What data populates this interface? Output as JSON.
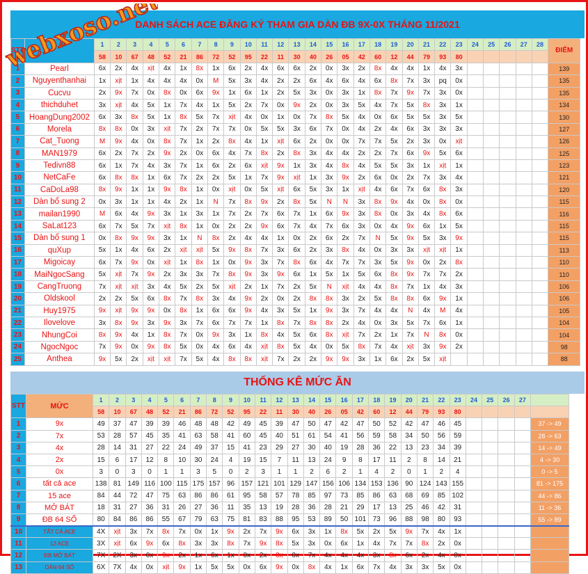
{
  "title": "DANH SÁCH ACE ĐĂNG KÝ THAM GIA DÀN ĐB 9X-0X THÁNG 11/2021",
  "logo": "webxoso.net",
  "stat_title": "THỐNG KÊ MỨC ĂN",
  "stt_label": "STT",
  "muc_label": "MỨC",
  "diem_label": "ĐIỂM",
  "days": [
    "1",
    "2",
    "3",
    "4",
    "5",
    "6",
    "7",
    "8",
    "9",
    "10",
    "11",
    "12",
    "13",
    "14",
    "15",
    "16",
    "17",
    "18",
    "19",
    "20",
    "21",
    "22",
    "23",
    "24",
    "25",
    "26",
    "27",
    "28"
  ],
  "stat_days": [
    "1",
    "2",
    "3",
    "4",
    "5",
    "6",
    "7",
    "8",
    "9",
    "10",
    "11",
    "12",
    "13",
    "14",
    "15",
    "16",
    "17",
    "18",
    "19",
    "20",
    "21",
    "22",
    "23",
    "24",
    "25",
    "26",
    "27"
  ],
  "results": [
    "58",
    "10",
    "67",
    "48",
    "52",
    "21",
    "86",
    "72",
    "52",
    "95",
    "22",
    "11",
    "30",
    "40",
    "26",
    "05",
    "42",
    "60",
    "12",
    "44",
    "79",
    "93",
    "80"
  ],
  "members": [
    {
      "n": "Pearl",
      "d": [
        "6x",
        "2x",
        "4x",
        "xịt",
        "4x",
        "1x",
        "8x",
        "1x",
        "6x",
        "2x",
        "4x",
        "6x",
        "6x",
        "2x",
        "0x",
        "3x",
        "2x",
        "8x",
        "4x",
        "4x",
        "1x",
        "4x",
        "3x"
      ],
      "s": "139"
    },
    {
      "n": "Nguyenthanhai",
      "d": [
        "1x",
        "xịt",
        "1x",
        "4x",
        "4x",
        "4x",
        "0x",
        "M",
        "5x",
        "3x",
        "4x",
        "2x",
        "2x",
        "6x",
        "4x",
        "6x",
        "4x",
        "6x",
        "8x",
        "7x",
        "3x",
        "pq",
        "0x"
      ],
      "s": "135"
    },
    {
      "n": "Cucvu",
      "d": [
        "2x",
        "9x",
        "7x",
        "0x",
        "8x",
        "0x",
        "6x",
        "9x",
        "1x",
        "6x",
        "1x",
        "2x",
        "5x",
        "3x",
        "0x",
        "3x",
        "1x",
        "8x",
        "7x",
        "9x",
        "7x",
        "3x",
        "0x"
      ],
      "s": "135"
    },
    {
      "n": "thichduhet",
      "d": [
        "3x",
        "xịt",
        "4x",
        "5x",
        "1x",
        "7x",
        "4x",
        "1x",
        "5x",
        "2x",
        "7x",
        "0x",
        "9x",
        "2x",
        "0x",
        "3x",
        "5x",
        "4x",
        "7x",
        "5x",
        "8x",
        "3x",
        "1x"
      ],
      "s": "134"
    },
    {
      "n": "HoangDung2002",
      "d": [
        "6x",
        "3x",
        "8x",
        "5x",
        "1x",
        "8x",
        "5x",
        "7x",
        "xịt",
        "4x",
        "0x",
        "1x",
        "0x",
        "7x",
        "8x",
        "5x",
        "4x",
        "0x",
        "6x",
        "5x",
        "5x",
        "3x",
        "5x"
      ],
      "s": "130"
    },
    {
      "n": "Morela",
      "d": [
        "8x",
        "8x",
        "0x",
        "3x",
        "xịt",
        "7x",
        "2x",
        "7x",
        "7x",
        "0x",
        "5x",
        "5x",
        "3x",
        "6x",
        "7x",
        "0x",
        "4x",
        "2x",
        "4x",
        "6x",
        "3x",
        "3x",
        "3x"
      ],
      "s": "127"
    },
    {
      "n": "Cat_Tuong",
      "d": [
        "M",
        "9x",
        "4x",
        "0x",
        "8x",
        "7x",
        "1x",
        "2x",
        "8x",
        "4x",
        "1x",
        "xịt",
        "6x",
        "2x",
        "0x",
        "0x",
        "7x",
        "7x",
        "5x",
        "2x",
        "3x",
        "0x",
        "xịt"
      ],
      "s": "126"
    },
    {
      "n": "MAN1979",
      "d": [
        "6x",
        "2x",
        "7x",
        "2x",
        "9x",
        "2x",
        "0x",
        "6x",
        "4x",
        "7x",
        "8x",
        "2x",
        "8x",
        "3x",
        "4x",
        "4x",
        "2x",
        "2x",
        "7x",
        "6x",
        "9x",
        "5x",
        "6x"
      ],
      "s": "125"
    },
    {
      "n": "Tedivn88",
      "d": [
        "6x",
        "1x",
        "7x",
        "4x",
        "3x",
        "7x",
        "1x",
        "6x",
        "2x",
        "6x",
        "xịt",
        "9x",
        "1x",
        "3x",
        "4x",
        "8x",
        "4x",
        "5x",
        "5x",
        "3x",
        "1x",
        "xịt",
        "1x"
      ],
      "s": "123"
    },
    {
      "n": "NetCaFe",
      "d": [
        "6x",
        "8x",
        "8x",
        "1x",
        "6x",
        "7x",
        "2x",
        "2x",
        "5x",
        "1x",
        "7x",
        "9x",
        "xịt",
        "1x",
        "3x",
        "9x",
        "2x",
        "6x",
        "0x",
        "2x",
        "7x",
        "3x",
        "4x"
      ],
      "s": "121"
    },
    {
      "n": "CaDoLa98",
      "d": [
        "8x",
        "9x",
        "1x",
        "1x",
        "9x",
        "8x",
        "1x",
        "0x",
        "xịt",
        "0x",
        "5x",
        "xịt",
        "6x",
        "5x",
        "3x",
        "1x",
        "xịt",
        "4x",
        "6x",
        "7x",
        "6x",
        "8x",
        "3x"
      ],
      "s": "120"
    },
    {
      "n": "Dàn bổ sung 2",
      "d": [
        "0x",
        "3x",
        "1x",
        "1x",
        "4x",
        "2x",
        "1x",
        "N",
        "7x",
        "8x",
        "9x",
        "2x",
        "8x",
        "5x",
        "N",
        "N",
        "3x",
        "8x",
        "9x",
        "4x",
        "0x",
        "8x",
        "0x"
      ],
      "s": "115"
    },
    {
      "n": "mailan1990",
      "d": [
        "M",
        "6x",
        "4x",
        "9x",
        "3x",
        "1x",
        "3x",
        "1x",
        "7x",
        "2x",
        "7x",
        "6x",
        "7x",
        "1x",
        "6x",
        "9x",
        "3x",
        "8x",
        "0x",
        "3x",
        "4x",
        "8x",
        "6x"
      ],
      "s": "116"
    },
    {
      "n": "SaLat123",
      "d": [
        "6x",
        "7x",
        "5x",
        "7x",
        "xịt",
        "8x",
        "1x",
        "0x",
        "2x",
        "2x",
        "9x",
        "6x",
        "7x",
        "4x",
        "7x",
        "6x",
        "3x",
        "0x",
        "4x",
        "9x",
        "6x",
        "1x",
        "5x"
      ],
      "s": "115"
    },
    {
      "n": "Dàn bổ sung 1",
      "d": [
        "0x",
        "8x",
        "9x",
        "9x",
        "3x",
        "1x",
        "N",
        "8x",
        "2x",
        "4x",
        "4x",
        "1x",
        "0x",
        "2x",
        "6x",
        "2x",
        "7x",
        "N",
        "5x",
        "9x",
        "5x",
        "3x",
        "9x"
      ],
      "s": "115"
    },
    {
      "n": "quXup",
      "d": [
        "5x",
        "1x",
        "4x",
        "6x",
        "2x",
        "xịt",
        "xịt",
        "5x",
        "9x",
        "8x",
        "7x",
        "3x",
        "6x",
        "2x",
        "3x",
        "8x",
        "4x",
        "0x",
        "3x",
        "3x",
        "xịt",
        "xịt",
        "1x"
      ],
      "s": "113"
    },
    {
      "n": "Migoicay",
      "d": [
        "6x",
        "7x",
        "9x",
        "0x",
        "xịt",
        "1x",
        "8x",
        "1x",
        "0x",
        "9x",
        "3x",
        "7x",
        "8x",
        "6x",
        "4x",
        "7x",
        "7x",
        "3x",
        "5x",
        "9x",
        "0x",
        "2x",
        "8x"
      ],
      "s": "110"
    },
    {
      "n": "MaiNgocSang",
      "d": [
        "5x",
        "xịt",
        "7x",
        "9x",
        "2x",
        "3x",
        "3x",
        "7x",
        "8x",
        "9x",
        "3x",
        "9x",
        "6x",
        "1x",
        "5x",
        "1x",
        "5x",
        "6x",
        "8x",
        "9x",
        "7x",
        "7x",
        "2x"
      ],
      "s": "110"
    },
    {
      "n": "CangTruong",
      "d": [
        "7x",
        "xịt",
        "xịt",
        "3x",
        "4x",
        "5x",
        "2x",
        "5x",
        "xịt",
        "2x",
        "1x",
        "7x",
        "2x",
        "5x",
        "N",
        "xịt",
        "4x",
        "4x",
        "8x",
        "7x",
        "1x",
        "4x",
        "3x"
      ],
      "s": "106"
    },
    {
      "n": "Oldskool",
      "d": [
        "2x",
        "2x",
        "5x",
        "6x",
        "8x",
        "7x",
        "8x",
        "3x",
        "4x",
        "9x",
        "2x",
        "0x",
        "2x",
        "8x",
        "8x",
        "3x",
        "2x",
        "5x",
        "8x",
        "8x",
        "6x",
        "9x",
        "1x"
      ],
      "s": "106"
    },
    {
      "n": "Huy1975",
      "d": [
        "9x",
        "xịt",
        "9x",
        "9x",
        "0x",
        "8x",
        "1x",
        "6x",
        "6x",
        "9x",
        "4x",
        "3x",
        "5x",
        "1x",
        "9x",
        "3x",
        "7x",
        "4x",
        "4x",
        "N",
        "4x",
        "M",
        "4x"
      ],
      "s": "105"
    },
    {
      "n": "Ilovelove",
      "d": [
        "3x",
        "8x",
        "9x",
        "3x",
        "9x",
        "3x",
        "7x",
        "6x",
        "7x",
        "7x",
        "1x",
        "8x",
        "7x",
        "8x",
        "8x",
        "2x",
        "4x",
        "0x",
        "3x",
        "5x",
        "7x",
        "6x",
        "1x"
      ],
      "s": "104"
    },
    {
      "n": "NhungCoi",
      "d": [
        "8x",
        "9x",
        "4x",
        "1x",
        "8x",
        "7x",
        "0x",
        "9x",
        "3x",
        "1x",
        "8x",
        "4x",
        "5x",
        "6x",
        "8x",
        "xịt",
        "7x",
        "2x",
        "1x",
        "7x",
        "N",
        "8x",
        "0x"
      ],
      "s": "104"
    },
    {
      "n": "NgocNgoc",
      "d": [
        "7x",
        "9x",
        "0x",
        "9x",
        "8x",
        "5x",
        "0x",
        "4x",
        "6x",
        "4x",
        "xịt",
        "8x",
        "5x",
        "4x",
        "0x",
        "5x",
        "8x",
        "7x",
        "4x",
        "xịt",
        "3x",
        "9x",
        "2x"
      ],
      "s": "98"
    },
    {
      "n": "Anthea",
      "d": [
        "9x",
        "5x",
        "2x",
        "xịt",
        "xịt",
        "7x",
        "5x",
        "4x",
        "8x",
        "8x",
        "xịt",
        "7x",
        "2x",
        "2x",
        "9x",
        "9x",
        "3x",
        "1x",
        "6x",
        "2x",
        "5x",
        "xịt"
      ],
      "s": "88"
    }
  ],
  "levels": [
    {
      "n": "9x",
      "d": [
        "49",
        "37",
        "47",
        "39",
        "39",
        "46",
        "48",
        "48",
        "42",
        "49",
        "45",
        "39",
        "47",
        "50",
        "47",
        "42",
        "47",
        "50",
        "52",
        "42",
        "47",
        "46",
        "45"
      ],
      "r": "37 -> 49"
    },
    {
      "n": "7x",
      "d": [
        "53",
        "28",
        "57",
        "45",
        "35",
        "41",
        "63",
        "58",
        "41",
        "60",
        "45",
        "40",
        "51",
        "61",
        "54",
        "41",
        "56",
        "59",
        "58",
        "34",
        "50",
        "56",
        "59"
      ],
      "r": "28 -> 63"
    },
    {
      "n": "4x",
      "d": [
        "28",
        "14",
        "31",
        "27",
        "22",
        "24",
        "49",
        "37",
        "15",
        "41",
        "23",
        "29",
        "27",
        "30",
        "40",
        "19",
        "28",
        "36",
        "22",
        "13",
        "23",
        "34",
        "39"
      ],
      "r": "14 -> 49"
    },
    {
      "n": "2x",
      "d": [
        "15",
        "6",
        "17",
        "12",
        "8",
        "10",
        "30",
        "24",
        "4",
        "19",
        "15",
        "7",
        "11",
        "13",
        "24",
        "9",
        "8",
        "17",
        "11",
        "2",
        "8",
        "14",
        "21"
      ],
      "r": "4 -> 30"
    },
    {
      "n": "0x",
      "d": [
        "3",
        "0",
        "3",
        "0",
        "1",
        "1",
        "3",
        "5",
        "0",
        "2",
        "3",
        "1",
        "1",
        "2",
        "6",
        "2",
        "1",
        "4",
        "2",
        "0",
        "1",
        "2",
        "4"
      ],
      "r": "0 -> 5"
    },
    {
      "n": "tất cả ace",
      "d": [
        "138",
        "81",
        "149",
        "116",
        "100",
        "115",
        "175",
        "157",
        "96",
        "157",
        "121",
        "101",
        "129",
        "147",
        "156",
        "106",
        "134",
        "153",
        "136",
        "90",
        "124",
        "143",
        "155"
      ],
      "r": "81 -> 175"
    },
    {
      "n": "15 ace",
      "d": [
        "84",
        "44",
        "72",
        "47",
        "75",
        "63",
        "86",
        "86",
        "61",
        "95",
        "58",
        "57",
        "78",
        "85",
        "97",
        "73",
        "85",
        "86",
        "63",
        "68",
        "69",
        "85",
        "102"
      ],
      "r": "44 -> 86"
    },
    {
      "n": "MỞ BÁT",
      "d": [
        "18",
        "31",
        "27",
        "36",
        "31",
        "26",
        "27",
        "36",
        "11",
        "35",
        "13",
        "19",
        "28",
        "36",
        "28",
        "21",
        "29",
        "17",
        "13",
        "25",
        "46",
        "42",
        "31"
      ],
      "r": "11 -> 36"
    },
    {
      "n": "ĐB 64 SỐ",
      "d": [
        "80",
        "84",
        "86",
        "86",
        "55",
        "67",
        "79",
        "63",
        "75",
        "81",
        "83",
        "88",
        "95",
        "53",
        "89",
        "50",
        "101",
        "73",
        "96",
        "88",
        "98",
        "80",
        "93"
      ],
      "r": "55 -> 89"
    },
    {
      "n": "TẤT CẢ ACE",
      "d": [
        "4X",
        "xịt",
        "3x",
        "7x",
        "8x",
        "7x",
        "0x",
        "1x",
        "9x",
        "2x",
        "7x",
        "9x",
        "6x",
        "3x",
        "1x",
        "8x",
        "5x",
        "2x",
        "5x",
        "9x",
        "7x",
        "4x",
        "1x"
      ],
      "r": ""
    },
    {
      "n": "12 ACE",
      "d": [
        "3X",
        "xịt",
        "6x",
        "9x",
        "6x",
        "8x",
        "3x",
        "3x",
        "8x",
        "7x",
        "9x",
        "8x",
        "5x",
        "3x",
        "0x",
        "6x",
        "1x",
        "4x",
        "7x",
        "7x",
        "8x",
        "2x",
        "0x"
      ],
      "r": ""
    },
    {
      "n": "ĐB MỞ BÁT",
      "d": [
        "7X",
        "2X",
        "3x",
        "0x",
        "9x",
        "2x",
        "1x",
        "6x",
        "1x",
        "0x",
        "2x",
        "8x",
        "0x",
        "7x",
        "4x",
        "4x",
        "4x",
        "3x",
        "8x",
        "6x",
        "2x",
        "4x",
        "0x"
      ],
      "r": ""
    },
    {
      "n": "DÀN 64 SỐ",
      "d": [
        "6X",
        "7X",
        "4x",
        "0x",
        "xịt",
        "9x",
        "1x",
        "5x",
        "5x",
        "0x",
        "6x",
        "9x",
        "0x",
        "8x",
        "4x",
        "1x",
        "6x",
        "7x",
        "4x",
        "3x",
        "3x",
        "5x",
        "0x"
      ],
      "r": ""
    }
  ],
  "colors": {
    "banner": "#1aa8e0",
    "red": "#e81313",
    "score": "#f3a065",
    "day_header": "#d6eec4",
    "result_header": "#f9d2b4"
  }
}
